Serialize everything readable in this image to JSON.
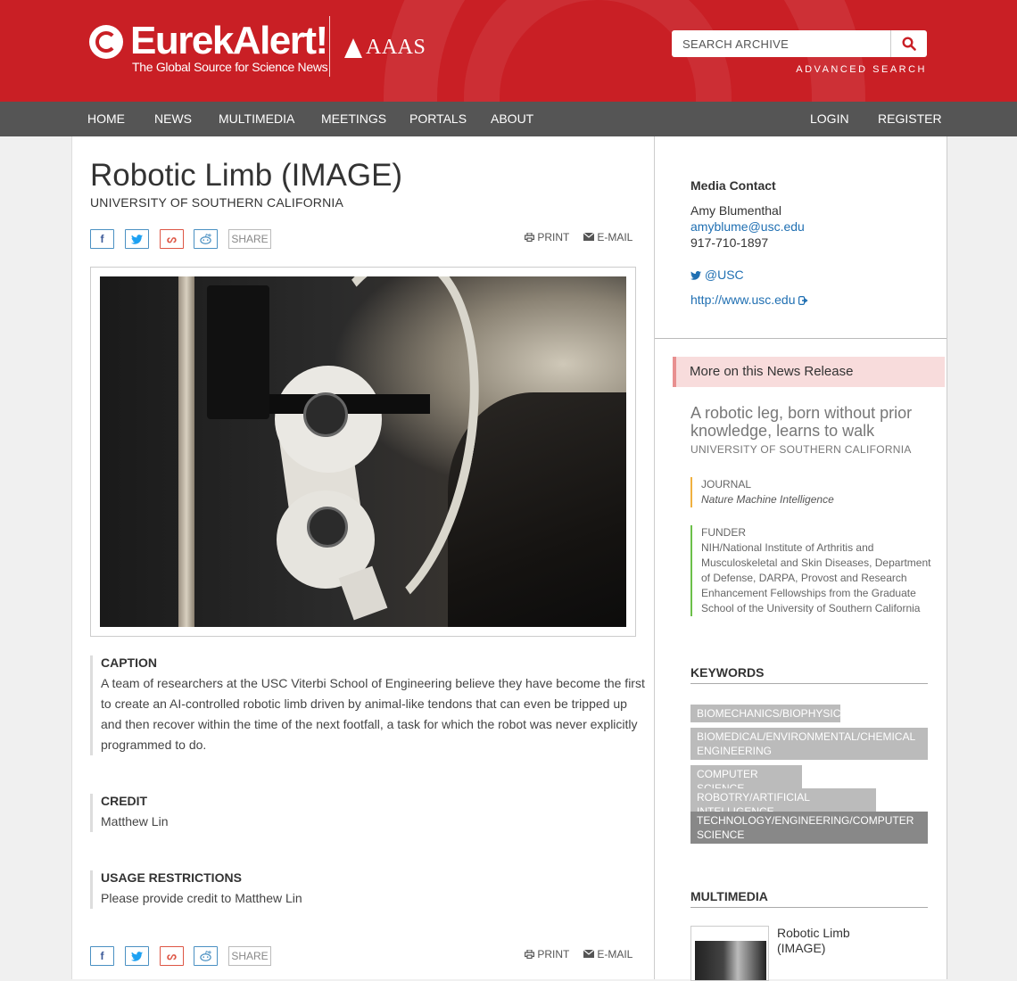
{
  "header": {
    "logo_title": "EurekAlert!",
    "logo_subtitle": "The Global Source for Science News",
    "partner": "AAAS",
    "search_placeholder": "SEARCH ARCHIVE",
    "advanced_search": "ADVANCED SEARCH",
    "brand_color": "#c91f25"
  },
  "nav": {
    "items": [
      "HOME",
      "NEWS",
      "MULTIMEDIA",
      "MEETINGS",
      "PORTALS",
      "ABOUT"
    ],
    "login": "LOGIN",
    "register": "REGISTER"
  },
  "page": {
    "title": "Robotic Limb (IMAGE)",
    "institution": "UNIVERSITY OF SOUTHERN CALIFORNIA",
    "share_label": "SHARE",
    "print_label": "PRINT",
    "email_label": "E-MAIL",
    "caption_title": "CAPTION",
    "caption_text": "A team of researchers at the USC Viterbi School of Engineering believe they have become the first to create an AI-controlled robotic limb driven by animal-like tendons that can even be tripped up and then recover within the time of the next footfall, a task for which the robot was never explicitly programmed to do.",
    "credit_title": "CREDIT",
    "credit_text": "Matthew Lin",
    "usage_title": "USAGE RESTRICTIONS",
    "usage_text": "Please provide credit to Matthew Lin"
  },
  "sidebar": {
    "media_contact_label": "Media Contact",
    "contact_name": "Amy Blumenthal",
    "contact_email": "amyblume@usc.edu",
    "contact_phone": "917-710-1897",
    "twitter": "@USC",
    "website": "http://www.usc.edu",
    "more_label": "More on this News Release",
    "related_title": "A robotic leg, born without prior knowledge, learns to walk",
    "related_institution": "UNIVERSITY OF SOUTHERN CALIFORNIA",
    "journal_label": "JOURNAL",
    "journal_value": "Nature Machine Intelligence",
    "funder_label": "FUNDER",
    "funder_value": "NIH/National Institute of Arthritis and Musculoskeletal and Skin Diseases, Department of Defense, DARPA, Provost and Research Enhancement Fellowships from the Graduate School of the University of Southern California",
    "keywords_heading": "KEYWORDS",
    "keywords": [
      "BIOMECHANICS/BIOPHYSICS",
      "BIOMEDICAL/ENVIRONMENTAL/CHEMICAL ENGINEERING",
      "COMPUTER SCIENCE",
      "ROBOTRY/ARTIFICIAL INTELLIGENCE",
      "TECHNOLOGY/ENGINEERING/COMPUTER SCIENCE"
    ],
    "multimedia_heading": "MULTIMEDIA",
    "multimedia_title": "Robotic Limb",
    "multimedia_type": "(IMAGE)"
  }
}
